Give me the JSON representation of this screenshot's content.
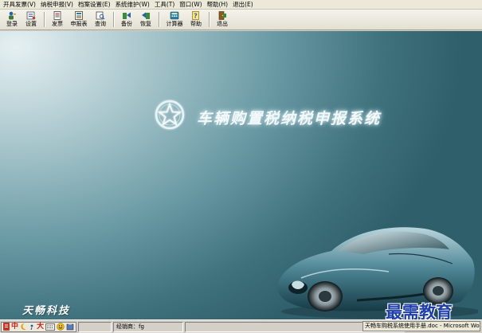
{
  "menubar": {
    "items": [
      {
        "label": "开具发票(V)"
      },
      {
        "label": "纳税申报(V)"
      },
      {
        "label": "档案设置(E)"
      },
      {
        "label": "系统维护(W)"
      },
      {
        "label": "工具(T)"
      },
      {
        "label": "窗口(W)"
      },
      {
        "label": "帮助(H)"
      },
      {
        "label": "退出(E)"
      }
    ]
  },
  "toolbar": {
    "login": "登录",
    "settings": "设置",
    "invoice": "发票",
    "declaration_form": "申报表",
    "query": "查询",
    "backup": "备份",
    "restore": "恢复",
    "calculator": "计算器",
    "help": "帮助",
    "exit": "退出"
  },
  "workspace": {
    "title": "车辆购置税纳税申报系统",
    "company": "天畅科技",
    "watermark": "最需教育"
  },
  "statusbar": {
    "ime": {
      "mode": "中",
      "width": "大"
    },
    "operator_label": "经销商：fg",
    "taskbar_item": "天畅车购税系统使用手册.doc - Microsoft Word"
  },
  "colors": {
    "accent": "#2f5f6a",
    "watermark": "#1f3fa8"
  }
}
